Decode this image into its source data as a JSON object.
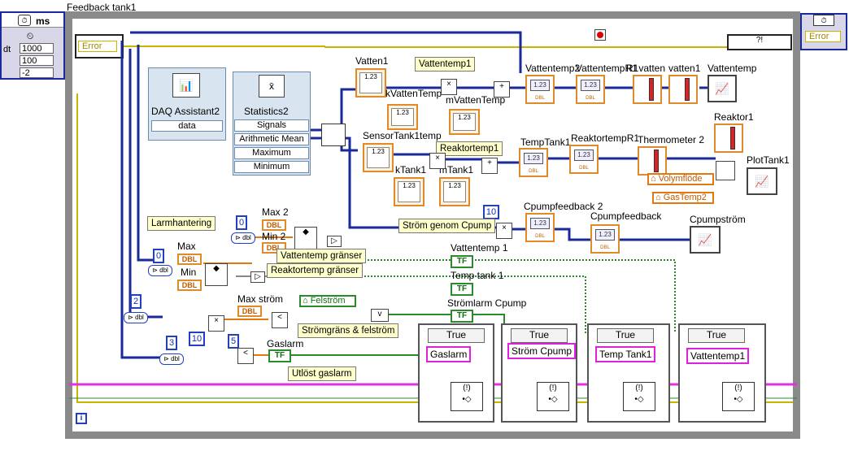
{
  "window": {
    "title": "Feedback tank1"
  },
  "left_panel": {
    "unit": "ms",
    "dt_label": "dt",
    "dt_value": "1000",
    "n_value": "100",
    "sub_value": "-2"
  },
  "error_in": "Error",
  "error_out": "Error",
  "daq": {
    "title": "DAQ Assistant2",
    "out": "data"
  },
  "stats": {
    "title": "Statistics2",
    "rows": [
      "Signals",
      "Arithmetic Mean",
      "Maximum",
      "Minimum"
    ]
  },
  "labels": {
    "vatten1": "Vatten1",
    "kVattenTemp": "kVattenTemp",
    "sensorTank1temp": "SensorTank1temp",
    "mVattenTemp": "mVattenTemp",
    "kTank1": "kTank1",
    "mTank1": "mTank1",
    "vattentemp2": "Vattentemp2",
    "vattentempR1": "VattentempR1",
    "r1vatten": "R1vatten",
    "vatten1b": "vatten1",
    "vattentemp": "Vattentemp",
    "tempTank1": "TempTank1",
    "reaktortempR1": "ReaktortempR1",
    "thermometer2": "Thermometer 2",
    "reaktor1": "Reaktor1",
    "plotTank1": "PlotTank1",
    "cpumpfeedback2": "Cpumpfeedback 2",
    "cpumpfeedback": "Cpumpfeedback",
    "cpumpstrom": "Cpumpström",
    "max2": "Max 2",
    "min2": "Min 2",
    "max": "Max",
    "min": "Min",
    "maxstrom": "Max ström",
    "gaslarm": "Gaslarm",
    "vattentemp1": "Vattentemp 1",
    "temptank1": "Temp tank 1",
    "stromlarmCpump": "Strömlarm Cpump",
    "volymflode": "Volymflöde",
    "gastemp2": "GasTemp2",
    "felstrom": "Felström"
  },
  "comments": {
    "vattentemp1": "Vattentemp1",
    "reaktortemp1": "Reaktortemp1",
    "stromGenomCpump": "Ström genom Cpump",
    "larmhantering": "Larmhantering",
    "vattentempGranser": "Vattentemp gränser",
    "reaktortempGranser": "Reaktortemp gränser",
    "stromgrans": "Strömgräns & felström",
    "utlostGaslarm": "Utlöst gaslarm"
  },
  "constants": {
    "c10top": "10",
    "c0a": "0",
    "c0b": "0",
    "c2": "2",
    "c10": "10",
    "c3": "3",
    "c5": "5"
  },
  "bool": "TF",
  "dbl": "DBL",
  "cases": [
    {
      "selector": "True",
      "tag": "Gaslarm"
    },
    {
      "selector": "True",
      "tag": "Ström Cpump"
    },
    {
      "selector": "True",
      "tag": "Temp Tank1"
    },
    {
      "selector": "True",
      "tag": "Vattentemp1"
    }
  ],
  "info_icon": "i",
  "num_display": "1.23",
  "thermo_scale": [
    "100",
    "50",
    "0"
  ],
  "colors": {
    "loop_frame": "#8a8a8a",
    "wire_blue": "#1a2a9a",
    "wire_orange": "#e07a10",
    "wire_pink": "#e030e0",
    "wire_green": "#2b8a2b",
    "wire_yellow": "#c9b400"
  }
}
